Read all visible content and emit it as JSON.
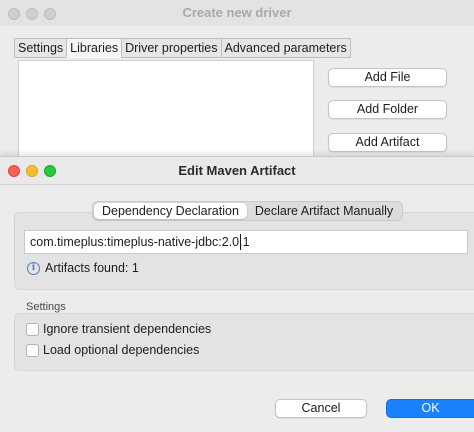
{
  "back_window": {
    "title": "Create new driver",
    "tabs": [
      {
        "label": "Settings",
        "active": false
      },
      {
        "label": "Libraries",
        "active": true
      },
      {
        "label": "Driver properties",
        "active": false
      },
      {
        "label": "Advanced parameters",
        "active": false
      }
    ],
    "buttons": {
      "add_file": "Add File",
      "add_folder": "Add Folder",
      "add_artifact": "Add Artifact"
    }
  },
  "dialog": {
    "title": "Edit Maven Artifact",
    "segments": [
      {
        "label": "Dependency Declaration",
        "active": true
      },
      {
        "label": "Declare Artifact Manually",
        "active": false
      }
    ],
    "dependency_value": "com.timeplus:timeplus-native-jdbc:2.0.1",
    "artifacts_found": "Artifacts found: 1",
    "settings_label": "Settings",
    "options": [
      {
        "label": "Ignore transient dependencies",
        "checked": false
      },
      {
        "label": "Load optional dependencies",
        "checked": false
      }
    ],
    "cancel_label": "Cancel",
    "ok_label": "OK"
  },
  "colors": {
    "accent": "#1a82fb",
    "close": "#ff5f57",
    "minimize": "#febc2e",
    "zoom": "#28c840",
    "info": "#4a7fd0"
  },
  "icons": {
    "info": "info-circle-icon",
    "traffic_lights": [
      "close-icon",
      "minimize-icon",
      "zoom-icon"
    ]
  }
}
